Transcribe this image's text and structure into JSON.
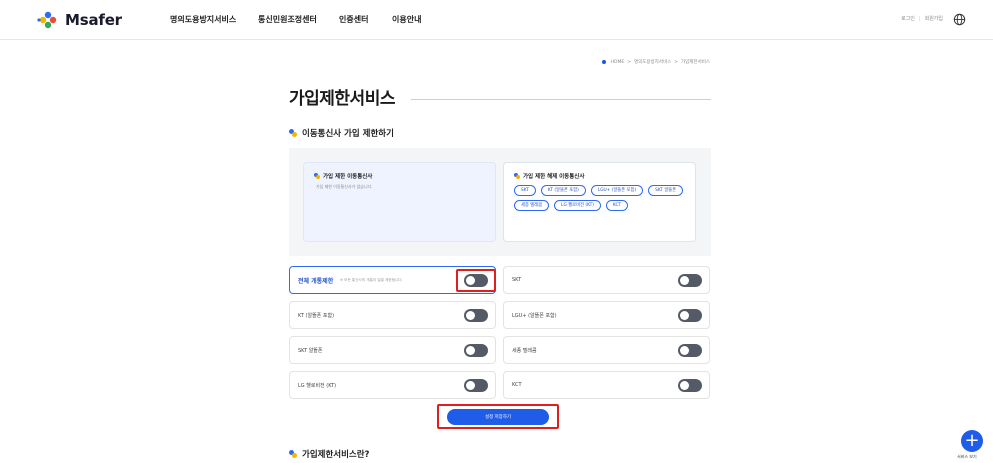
{
  "header": {
    "logo_text": "Msafer",
    "nav": [
      "명의도용방지서비스",
      "통신민원조정센터",
      "인증센터",
      "이용안내"
    ],
    "util_login": "로그인",
    "util_join": "회원가입"
  },
  "breadcrumb": {
    "home": "HOME",
    "level1": "명의도용방지서비스",
    "level2": "가입제한서비스",
    "separator": ">"
  },
  "page_title": "가입제한서비스",
  "section1_title": "이동통신사 가입 제한하기",
  "restricted_box": {
    "title": "가입 제한 이동통신사",
    "desc": "가입 제한 이동통신사가 없습니다."
  },
  "released_box": {
    "title": "가입 제한 해제 이동통신사",
    "chips": [
      "SKT",
      "KT (알뜰폰 포함)",
      "LGU+ (알뜰폰 포함)",
      "SKT 알뜰폰",
      "세종 텔레콤",
      "LG 헬로비전 (KT)",
      "KCT"
    ]
  },
  "toggles": {
    "all": {
      "label": "전체 개통제한",
      "note": "※ 모든 통신사의 개통이 일괄 제한됩니다.",
      "on": false
    },
    "skt": {
      "label": "SKT",
      "on": false
    },
    "kt": {
      "label": "KT (알뜰폰 포함)",
      "on": false
    },
    "lgu": {
      "label": "LGU+ (알뜰폰 포함)",
      "on": false
    },
    "skt_mvno": {
      "label": "SKT 알뜰폰",
      "on": false
    },
    "sejong": {
      "label": "세종 텔레콤",
      "on": false
    },
    "lg_hello": {
      "label": "LG 헬로비전 (KT)",
      "on": false
    },
    "kct": {
      "label": "KCT",
      "on": false
    }
  },
  "save_button": "설정 저장하기",
  "section2_title": "가입제한서비스란?",
  "fab": {
    "icon": "plus-icon",
    "label": "서비스 보기"
  },
  "colors": {
    "accent": "#1f5ce8",
    "highlight": "#e01e1e",
    "toggle_off": "#555b66"
  }
}
